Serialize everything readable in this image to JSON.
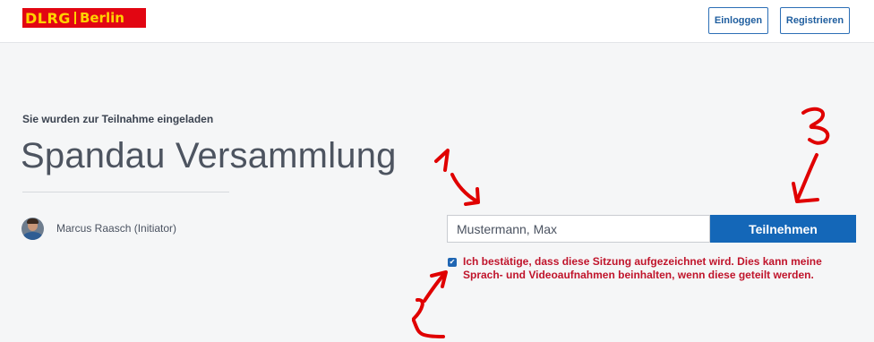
{
  "header": {
    "logo_text": "DLRG",
    "logo_city": "Berlin",
    "login_label": "Einloggen",
    "register_label": "Registrieren"
  },
  "invite": {
    "label": "Sie wurden zur Teilnahme eingeladen",
    "title": "Spandau Versammlung",
    "initiator": "Marcus Raasch (Initiator)"
  },
  "join": {
    "name_value": "Mustermann, Max",
    "join_label": "Teilnehmen",
    "consent_checked": true,
    "consent_text": "Ich bestätige, dass diese Sitzung aufgezeichnet wird. Dies kann meine Sprach- und Videoaufnahmen beinhalten, wenn diese geteilt werden."
  },
  "colors": {
    "brand_red": "#e20612",
    "brand_yellow": "#ffd200",
    "primary_blue": "#1467b8",
    "consent_red": "#c0142b",
    "annotation_red": "#e00000"
  },
  "annotations": [
    "1",
    "2",
    "3"
  ]
}
